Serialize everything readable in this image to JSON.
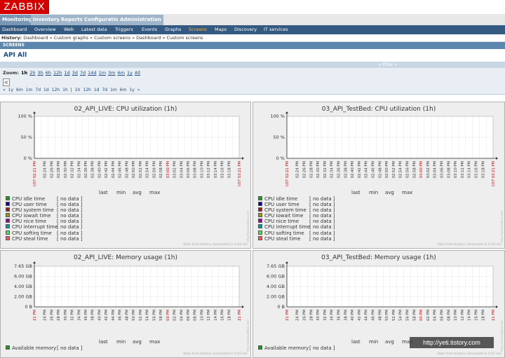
{
  "app": {
    "logo": "ZABBIX"
  },
  "main_menu": [
    {
      "label": "Monitoring",
      "active": true
    },
    {
      "label": "Inventory",
      "active": false
    },
    {
      "label": "Reports",
      "active": false
    },
    {
      "label": "Configuration",
      "active": false
    },
    {
      "label": "Administration",
      "active": false
    }
  ],
  "sub_menu": [
    {
      "label": "Dashboard",
      "active": false
    },
    {
      "label": "Overview",
      "active": false
    },
    {
      "label": "Web",
      "active": false
    },
    {
      "label": "Latest data",
      "active": false
    },
    {
      "label": "Triggers",
      "active": false
    },
    {
      "label": "Events",
      "active": false
    },
    {
      "label": "Graphs",
      "active": false
    },
    {
      "label": "Screens",
      "active": true
    },
    {
      "label": "Maps",
      "active": false
    },
    {
      "label": "Discovery",
      "active": false
    },
    {
      "label": "IT services",
      "active": false
    }
  ],
  "history": {
    "label": "History:",
    "path": "Dashboard » Custom graphs » Custom screens » Dashboard » Custom screens"
  },
  "section_header": "SCREENS",
  "screen_title": "API All",
  "filter_label": "« Filter »",
  "zoom": {
    "label": "Zoom:",
    "options": [
      "1h",
      "2h",
      "3h",
      "6h",
      "12h",
      "1d",
      "3d",
      "7d",
      "14d",
      "1m",
      "3m",
      "6m",
      "1y",
      "All"
    ],
    "active": "1h"
  },
  "scroll_left_glyph": "<",
  "period_nav": {
    "back": [
      "«",
      "1y",
      "6m",
      "1m",
      "7d",
      "1d",
      "12h",
      "1h",
      "|"
    ],
    "forward": [
      "1h",
      "12h",
      "1d",
      "7d",
      "1m",
      "6m",
      "1y",
      "»"
    ]
  },
  "time_labels": [
    "02:24 PM",
    "02:26 PM",
    "02:28 PM",
    "02:30 PM",
    "02:32 PM",
    "02:34 PM",
    "02:36 PM",
    "02:38 PM",
    "02:40 PM",
    "02:42 PM",
    "02:44 PM",
    "02:46 PM",
    "02:48 PM",
    "02:50 PM",
    "02:52 PM",
    "02:54 PM",
    "02:56 PM",
    "02:58 PM",
    "03:00 PM",
    "03:02 PM",
    "03:04 PM",
    "03:06 PM",
    "03:08 PM",
    "03:10 PM",
    "03:12 PM",
    "03:14 PM",
    "03:16 PM",
    "03:18 PM"
  ],
  "highlight_time": "03:00 PM",
  "time_start": "12/07 02:21 PM",
  "time_end": "12/07 03:21 PM",
  "legend_header": {
    "last": "last",
    "min": "min",
    "avg": "avg",
    "max": "max"
  },
  "no_data": "[ no data ]",
  "footnote_cpu": "Data from history. Generated in 0.18 sec",
  "footnote_mem": "Data from history. Generated in 0.07 sec",
  "vertical_note": "http://www.zabbix.com",
  "colors": {
    "logo_red": "#d40000",
    "menu_blue": "#345a82",
    "active_submenu": "#f0b848",
    "axis_red": "#cc0000"
  },
  "graphs": [
    {
      "title": "02_API_LIVE: CPU utilization (1h)",
      "kind": "cpu",
      "y_ticks": [
        "100 %",
        "50 %",
        "0 %"
      ],
      "legend": [
        {
          "name": "CPU idle time",
          "color": "#1a9e1a"
        },
        {
          "name": "CPU user time",
          "color": "#000099"
        },
        {
          "name": "CPU system time",
          "color": "#a01c1c"
        },
        {
          "name": "CPU iowait time",
          "color": "#999900"
        },
        {
          "name": "CPU nice time",
          "color": "#9a009a"
        },
        {
          "name": "CPU interrupt time",
          "color": "#009999"
        },
        {
          "name": "CPU softirq time",
          "color": "#55dd55"
        },
        {
          "name": "CPU steal time",
          "color": "#ff5555"
        }
      ]
    },
    {
      "title": "03_API_TestBed: CPU utilization (1h)",
      "kind": "cpu",
      "y_ticks": [
        "100 %",
        "50 %",
        "0 %"
      ],
      "legend": [
        {
          "name": "CPU idle time",
          "color": "#1a9e1a"
        },
        {
          "name": "CPU user time",
          "color": "#000099"
        },
        {
          "name": "CPU system time",
          "color": "#a01c1c"
        },
        {
          "name": "CPU iowait time",
          "color": "#999900"
        },
        {
          "name": "CPU nice time",
          "color": "#9a009a"
        },
        {
          "name": "CPU interrupt time",
          "color": "#009999"
        },
        {
          "name": "CPU softirq time",
          "color": "#55dd55"
        },
        {
          "name": "CPU steal time",
          "color": "#ff5555"
        }
      ]
    },
    {
      "title": "02_API_LIVE: Memory usage (1h)",
      "kind": "mem",
      "y_ticks": [
        "7.65 GB",
        "6.00 GB",
        "4.00 GB",
        "2.00 GB",
        "0 B"
      ],
      "legend": [
        {
          "name": "Available memory",
          "color": "#1a9e1a"
        }
      ]
    },
    {
      "title": "03_API_TestBed: Memory usage (1h)",
      "kind": "mem",
      "y_ticks": [
        "7.65 GB",
        "6.00 GB",
        "4.00 GB",
        "2.00 GB",
        "0 B"
      ],
      "legend": [
        {
          "name": "Available memory",
          "color": "#1a9e1a"
        }
      ]
    }
  ],
  "watermark": "http://yeti.tistory.com"
}
